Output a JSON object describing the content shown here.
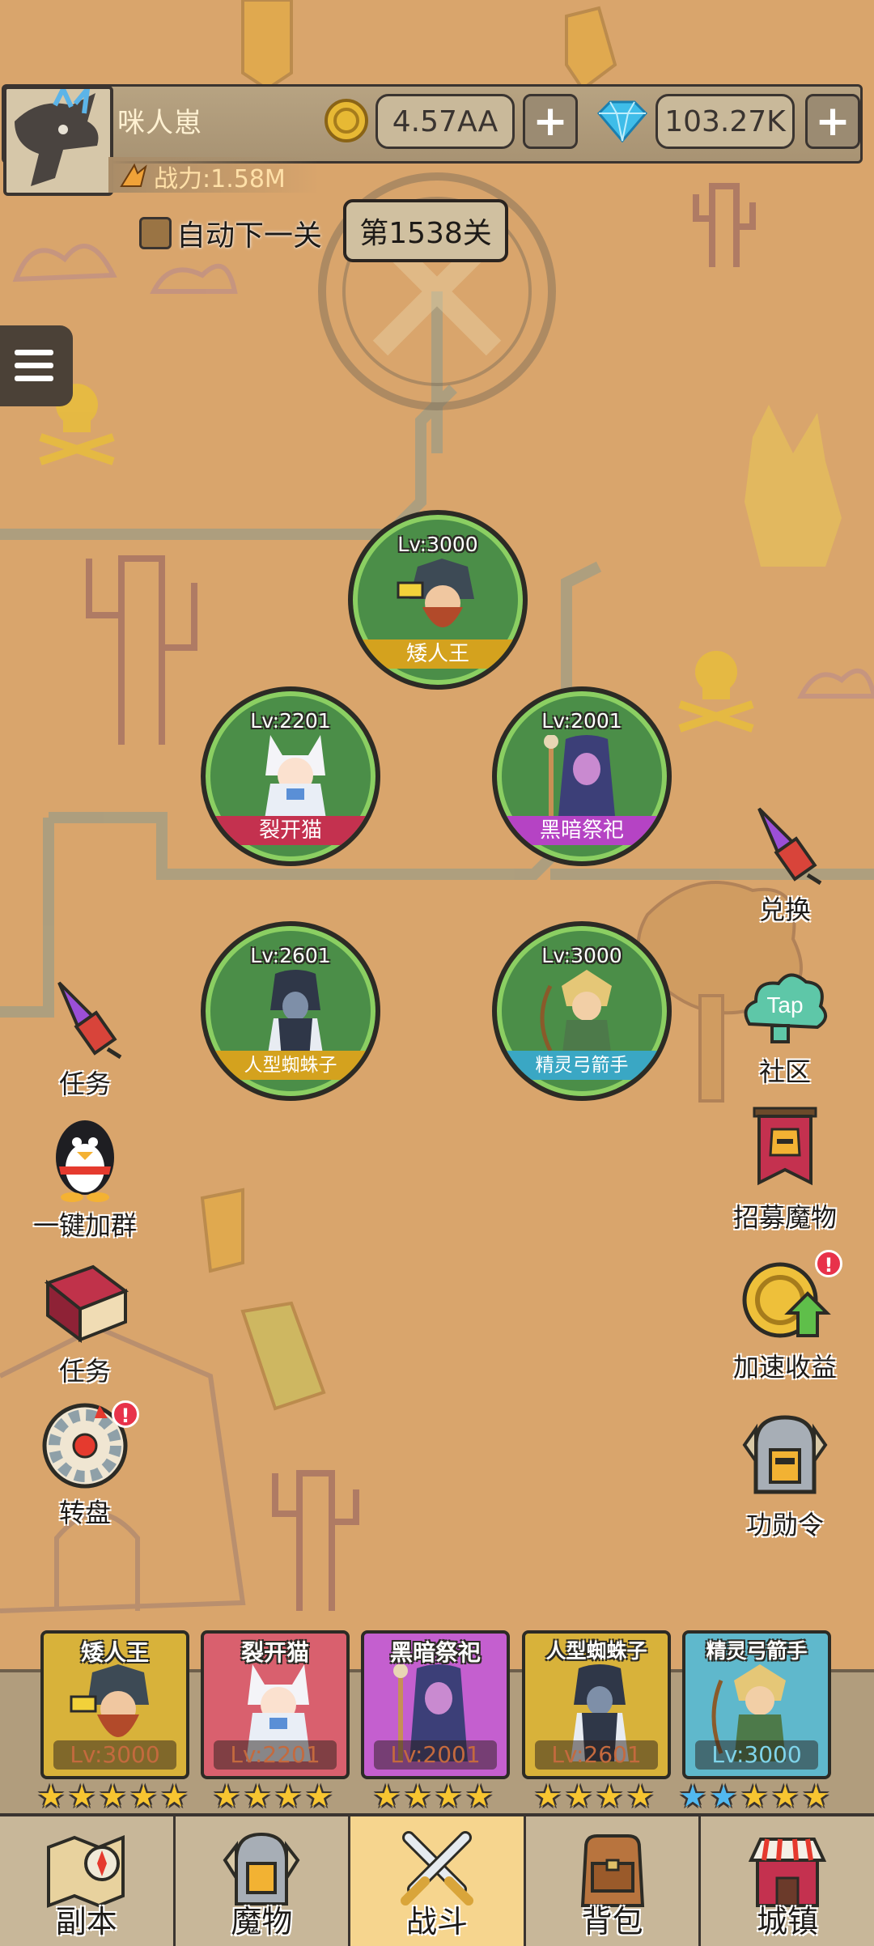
{
  "player": {
    "name": "咪人崽",
    "gold": "4.57AA",
    "gems": "103.27K",
    "plus_label": "+",
    "power_label": "战力:1.58M"
  },
  "stage": {
    "auto_next_label": "自动下一关",
    "current": "第1538关"
  },
  "team_circles": [
    {
      "name": "矮人王",
      "level": "Lv:3000",
      "name_bar_color": "#d4a21e"
    },
    {
      "name": "裂开猫",
      "level": "Lv:2201",
      "name_bar_color": "#c4314f"
    },
    {
      "name": "黑暗祭祀",
      "level": "Lv:2001",
      "name_bar_color": "#b543c4"
    },
    {
      "name": "人型蜘蛛子",
      "level": "Lv:2601",
      "name_bar_color": "#d4a21e"
    },
    {
      "name": "精灵弓箭手",
      "level": "Lv:3000",
      "name_bar_color": "#3aa7c4"
    }
  ],
  "left_buttons": [
    {
      "label": "任务",
      "icon": "firework-rocket-icon"
    },
    {
      "label": "一键加群",
      "icon": "penguin-icon"
    },
    {
      "label": "任务",
      "icon": "spellbook-icon"
    },
    {
      "label": "转盘",
      "icon": "roulette-wheel-icon",
      "alert": "!"
    }
  ],
  "right_buttons": [
    {
      "label": "兑换",
      "icon": "firework-rocket-icon"
    },
    {
      "label": "社区",
      "icon": "tap-cloud-icon",
      "icon_text": "Tap"
    },
    {
      "label": "招募魔物",
      "icon": "banner-helmet-icon"
    },
    {
      "label": "加速收益",
      "icon": "coin-arrow-icon",
      "alert": "!"
    },
    {
      "label": "功勋令",
      "icon": "knight-helmet-icon"
    }
  ],
  "team_cards": [
    {
      "name": "矮人王",
      "level": "Lv:3000",
      "stars": 5,
      "blue_stars": 0,
      "bg": "#d8b23a"
    },
    {
      "name": "裂开猫",
      "level": "Lv:2201",
      "stars": 4,
      "blue_stars": 0,
      "bg": "#d9606e"
    },
    {
      "name": "黑暗祭祀",
      "level": "Lv:2001",
      "stars": 4,
      "blue_stars": 0,
      "bg": "#c45fcf"
    },
    {
      "name": "人型蜘蛛子",
      "level": "Lv:2601",
      "stars": 4,
      "blue_stars": 0,
      "bg": "#d8b23a"
    },
    {
      "name": "精灵弓箭手",
      "level": "Lv:3000",
      "stars": 5,
      "blue_stars": 2,
      "bg": "#5fb8cc"
    }
  ],
  "bottom_nav": [
    {
      "label": "副本",
      "icon": "map-compass-icon"
    },
    {
      "label": "魔物",
      "icon": "monster-helmet-icon"
    },
    {
      "label": "战斗",
      "icon": "crossed-swords-icon",
      "active": true
    },
    {
      "label": "背包",
      "icon": "backpack-icon"
    },
    {
      "label": "城镇",
      "icon": "shop-house-icon"
    }
  ]
}
